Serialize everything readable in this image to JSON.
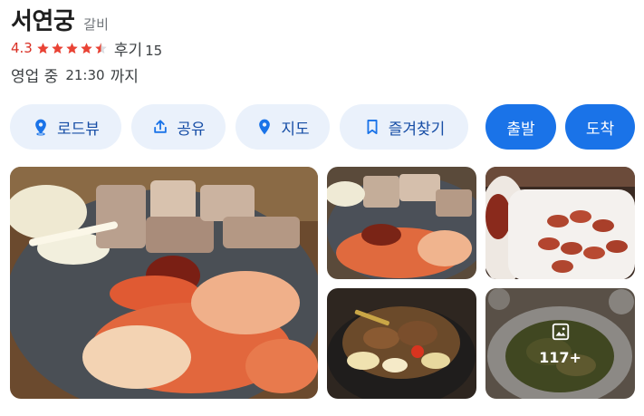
{
  "place": {
    "name": "서연궁",
    "category": "갈비",
    "rating": "4.3",
    "rating_fraction": 0.86,
    "reviews_label": "후기",
    "reviews_count": "15",
    "status": "영업 중",
    "closing_time": "21:30",
    "closing_suffix": "까지"
  },
  "actions": {
    "roadview": "로드뷰",
    "share": "공유",
    "map": "지도",
    "favorite": "즐겨찾기",
    "depart": "출발",
    "arrive": "도착"
  },
  "gallery": {
    "more_count": "117+"
  },
  "colors": {
    "rating": "#d93025",
    "star": "#e94335",
    "chip_bg": "#eaf1fb",
    "chip_text": "#174ea6",
    "primary": "#1a73e8"
  }
}
